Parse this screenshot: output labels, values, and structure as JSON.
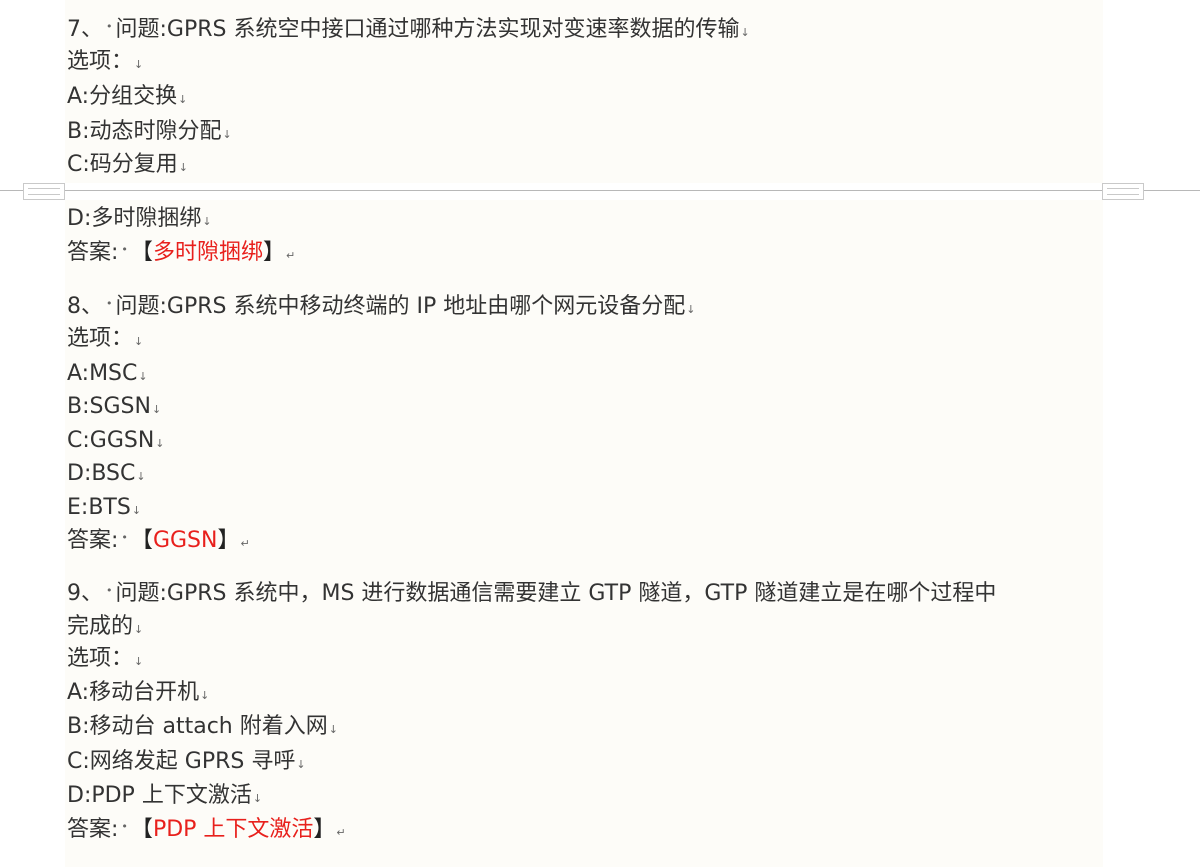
{
  "questions": [
    {
      "number": "7、",
      "question": "问题:GPRS 系统空中接口通过哪种方法实现对变速率数据的传输",
      "options_label": "选项：",
      "options": [
        "A:分组交换",
        "B:动态时隙分配",
        "C:码分复用",
        "D:多时隙捆绑"
      ],
      "answer_label": "答案:",
      "answer": "多时隙捆绑"
    },
    {
      "number": "8、",
      "question": "问题:GPRS 系统中移动终端的 IP 地址由哪个网元设备分配",
      "options_label": "选项：",
      "options": [
        "A:MSC",
        "B:SGSN",
        "C:GGSN",
        "D:BSC",
        "E:BTS"
      ],
      "answer_label": "答案:",
      "answer": "GGSN"
    },
    {
      "number": "9、",
      "question_line1": "问题:GPRS 系统中，MS 进行数据通信需要建立 GTP 隧道，GTP 隧道建立是在哪个过程中",
      "question_line2": "完成的",
      "options_label": "选项：",
      "options": [
        "A:移动台开机",
        "B:移动台 attach 附着入网",
        "C:网络发起 GPRS 寻呼",
        "D:PDP 上下文激活"
      ],
      "answer_label": "答案:",
      "answer": "PDP 上下文激活"
    }
  ],
  "marks": {
    "paragraph": "↵",
    "line_break": "↓",
    "bullet": "•",
    "bracket_open": "【",
    "bracket_close": "】"
  }
}
